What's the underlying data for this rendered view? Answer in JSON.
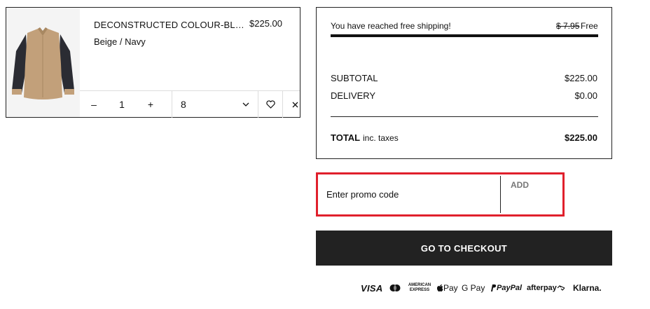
{
  "item": {
    "name": "DECONSTRUCTED COLOUR-BL…",
    "price": "$225.00",
    "variant": "Beige / Navy",
    "quantity": "1",
    "decrement_label": "–",
    "increment_label": "+",
    "size": "8",
    "image_icon": "shirt-image"
  },
  "summary": {
    "shipping_message": "You have reached free shipping!",
    "shipping_old_price": "$ 7.95",
    "shipping_new_price": "Free",
    "shipping_progress": 1.0,
    "subtotal_label": "SUBTOTAL",
    "subtotal_value": "$225.00",
    "delivery_label": "DELIVERY",
    "delivery_value": "$0.00",
    "total_label": "TOTAL",
    "total_tax_note": "inc. taxes",
    "total_value": "$225.00"
  },
  "promo": {
    "placeholder": "Enter promo code",
    "add_label": "ADD",
    "highlight_color": "#e0202c"
  },
  "checkout": {
    "label": "GO TO CHECKOUT"
  },
  "payments": {
    "visa": "VISA",
    "amex": "AMERICAN EXPRESS",
    "apple_pay": "Pay",
    "google_pay": "G Pay",
    "paypal": "PayPal",
    "afterpay": "afterpay",
    "klarna": "Klarna."
  }
}
